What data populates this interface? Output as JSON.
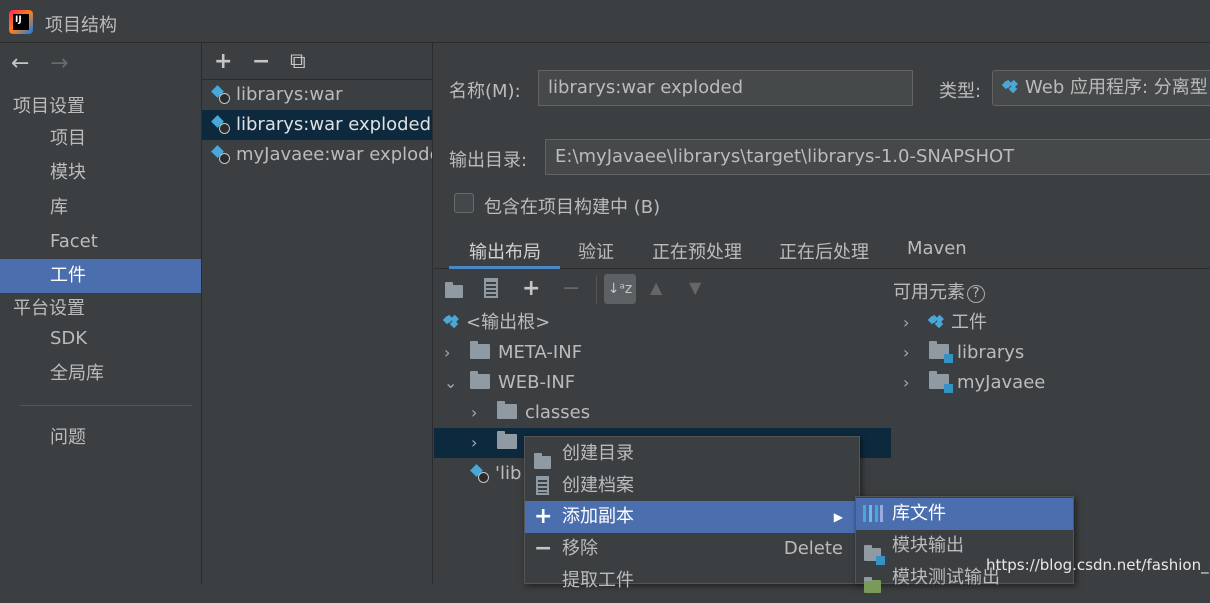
{
  "window": {
    "title": "项目结构"
  },
  "left_nav": {
    "back": "←",
    "forward": "→",
    "project_settings_header": "项目设置",
    "items": [
      "项目",
      "模块",
      "库",
      "Facet",
      "工件"
    ],
    "platform_settings_header": "平台设置",
    "platform_items": [
      "SDK",
      "全局库"
    ],
    "problems": "问题",
    "selected": "工件"
  },
  "artifact_toolbar": {
    "add": "+",
    "remove": "−",
    "copy": "⧉"
  },
  "artifacts": [
    "librarys:war",
    "librarys:war exploded",
    "myJavaee:war exploded"
  ],
  "selected_artifact": "librarys:war exploded",
  "form": {
    "name_label": "名称(M):",
    "name_value": "librarys:war exploded",
    "type_label": "类型:",
    "type_value": "Web 应用程序: 分离型",
    "output_label": "输出目录:",
    "output_value": "E:\\myJavaee\\librarys\\target\\librarys-1.0-SNAPSHOT",
    "include_build_label": "包含在项目构建中 (B)"
  },
  "tabs": [
    "输出布局",
    "验证",
    "正在预处理",
    "正在后处理",
    "Maven"
  ],
  "active_tab": "输出布局",
  "available_label": "可用元素",
  "output_tree": [
    {
      "label": "<输出根>"
    },
    {
      "label": "META-INF"
    },
    {
      "label": "WEB-INF"
    },
    {
      "label": "classes"
    },
    {
      "label": ""
    },
    {
      "label": "'lib"
    }
  ],
  "available_tree": [
    "工件",
    "librarys",
    "myJavaee"
  ],
  "context_menu": [
    {
      "label": "创建目录",
      "icon": "new-folder-icon"
    },
    {
      "label": "创建档案",
      "icon": "archive-icon"
    },
    {
      "label": "添加副本",
      "icon": "plus-icon",
      "submenu": true
    },
    {
      "label": "移除",
      "icon": "minus-icon",
      "shortcut": "Delete"
    },
    {
      "label": "提取工件",
      "icon": ""
    }
  ],
  "submenu": [
    "库文件",
    "模块输出",
    "模块测试输出"
  ],
  "watermark": "https://blog.csdn.net/fashion_h"
}
